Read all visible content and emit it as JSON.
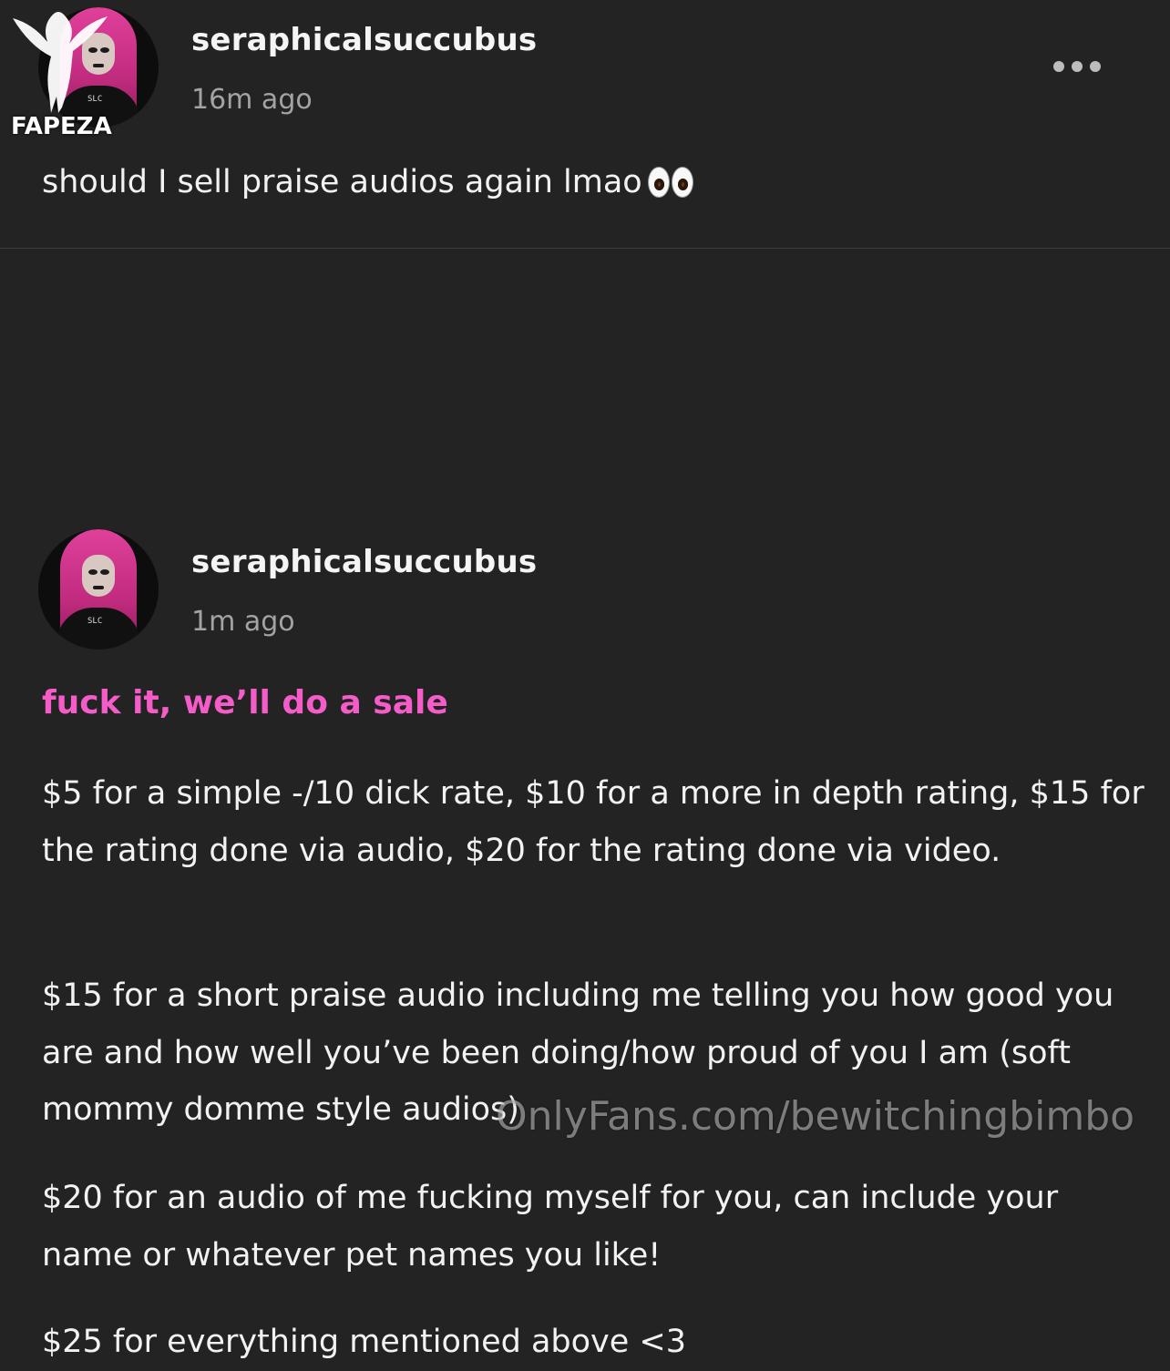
{
  "post1": {
    "username": "seraphicalsuccubus",
    "time": "16m ago",
    "text": "should I sell praise audios again lmao",
    "emoji": "eyes-emoji"
  },
  "post2": {
    "username": "seraphicalsuccubus",
    "time": "1m ago",
    "headline": "fuck it, we’ll do a sale",
    "paragraphs": [
      "$5 for a simple -/10 dick rate, $10 for a more in depth rating, $15 for the rating done via audio, $20 for the rating done via video.",
      "$15 for a short praise audio including me telling you how good you are and how well you’ve been doing/how proud of you I am (soft mommy domme style audios)",
      "$20 for an audio of me fucking myself for you, can include your name or whatever pet names you like!",
      "$25 for everything mentioned above <3"
    ]
  },
  "watermarks": {
    "logo_text": "FAPEZA",
    "footer": "OnlyFans.com/bewitchingbimbo"
  },
  "icons": {
    "more": "more-options-icon"
  },
  "colors": {
    "background": "#232323",
    "accent": "#f45cc8",
    "muted": "#a3a3a3"
  },
  "shirt_text": "SLC"
}
